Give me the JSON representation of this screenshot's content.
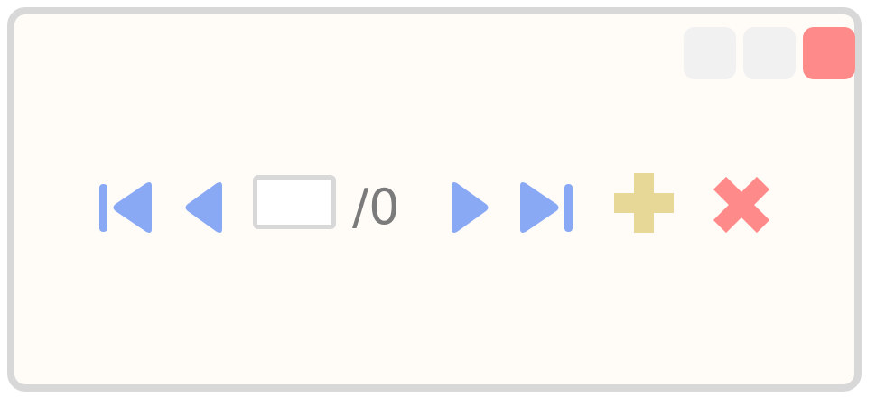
{
  "window": {
    "controls": [
      {
        "name": "minimize",
        "color": "#f1f1f1"
      },
      {
        "name": "maximize",
        "color": "#f1f1f1"
      },
      {
        "name": "close",
        "color": "#ff8a8a"
      }
    ]
  },
  "pager": {
    "current_page": "",
    "total_text": "/0",
    "nav_color": "#8aa9f5",
    "icons": {
      "first": "first-page-icon",
      "previous": "previous-page-icon",
      "next": "next-page-icon",
      "last": "last-page-icon",
      "add": "plus-icon",
      "remove": "x-icon"
    },
    "add_color": "#e8d898",
    "remove_color": "#ff8a8a"
  }
}
